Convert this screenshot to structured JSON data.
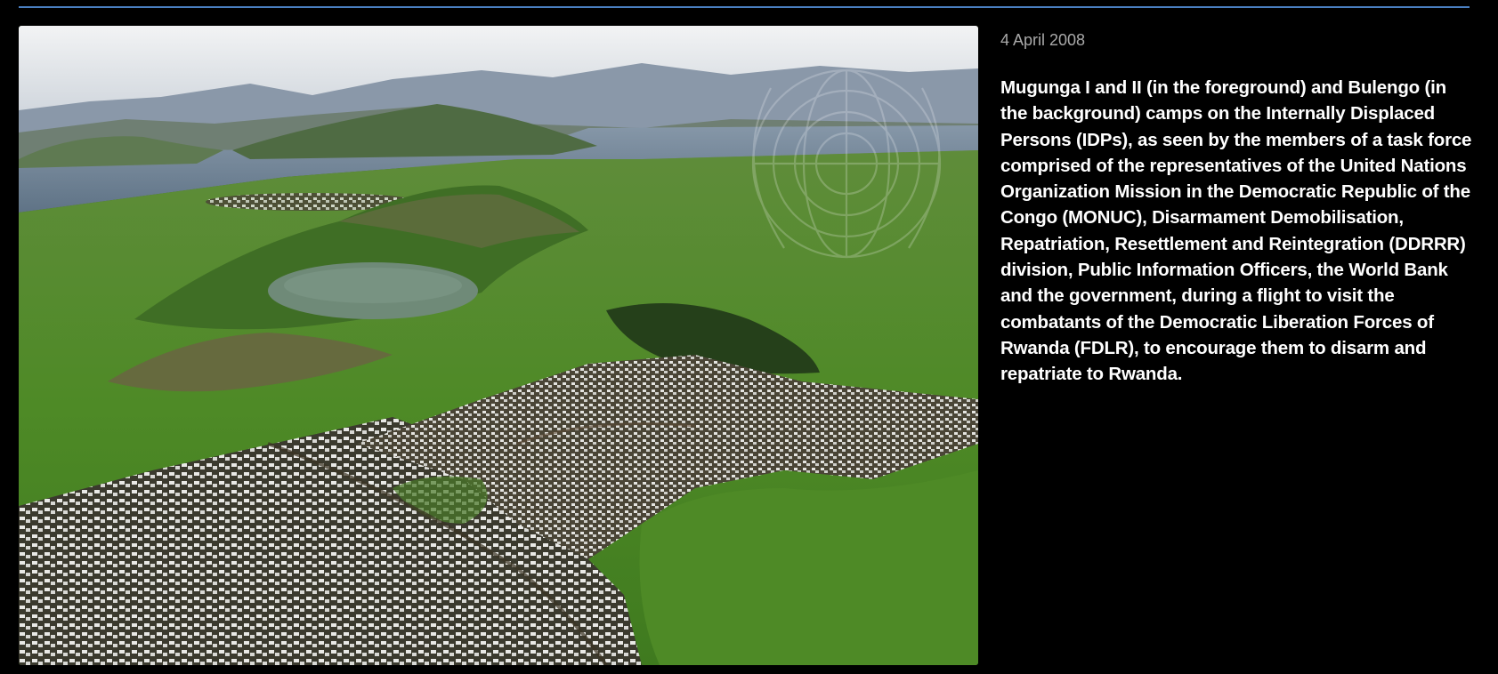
{
  "photo": {
    "subject": "aerial-photo-idp-camps",
    "colors": {
      "sky": "#e6e9ec",
      "mountains": "#7f8ea0",
      "lake": "#6f8396",
      "vegetation": "#4f8a2c",
      "crater_lake": "#6f8a78",
      "camp_tents": "#e8e8e8"
    }
  },
  "date": "4 April 2008",
  "caption": "Mugunga I and II (in the foreground) and Bulengo (in the background) camps on the Internally Displaced Persons (IDPs), as seen by the members of a task force comprised of the representatives of the United Nations Organization Mission in the Democratic Republic of the Congo (MONUC), Disarmament Demobilisation, Repatriation, Resettlement and Reintegration (DDRRR) division, Public Information Officers, the World Bank and the government, during a flight to visit the combatants of the Democratic Liberation Forces of Rwanda (FDLR), to encourage them to disarm and repatriate to Rwanda.",
  "accent_color": "#4a7fc1"
}
